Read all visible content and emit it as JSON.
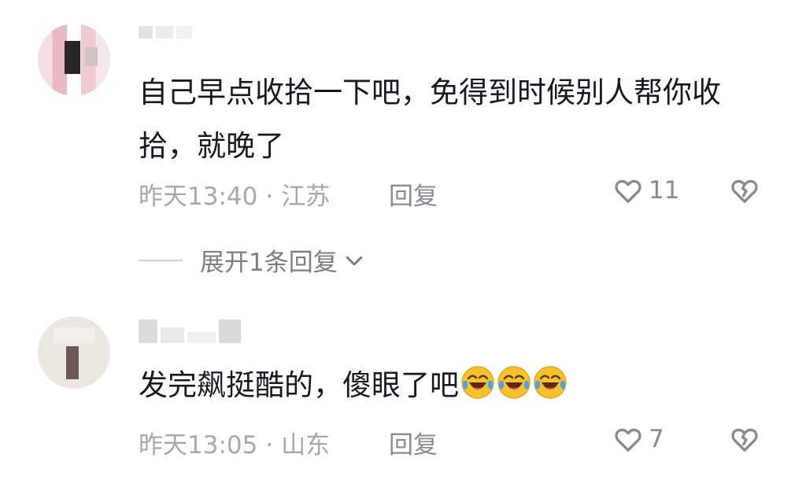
{
  "comments": [
    {
      "text": "自己早点收拾一下吧，免得到时候别人帮你收拾，就晚了",
      "time": "昨天13:40",
      "location": "江苏",
      "reply_label": "回复",
      "likes": "11",
      "expand_label": "展开1条回复"
    },
    {
      "text": "发完飙挺酷的，傻眼了吧",
      "emoji_count": 3,
      "emoji": "laughing-crying-emoji",
      "time": "昨天13:05",
      "location": "山东",
      "reply_label": "回复",
      "likes": "7"
    }
  ],
  "separator": "·",
  "icons": {
    "like": "heart-outline-icon",
    "dislike": "broken-heart-icon",
    "expand": "chevron-down-icon"
  },
  "colors": {
    "text": "#161823",
    "meta": "#a8a8ad",
    "action": "#8a8b91"
  }
}
